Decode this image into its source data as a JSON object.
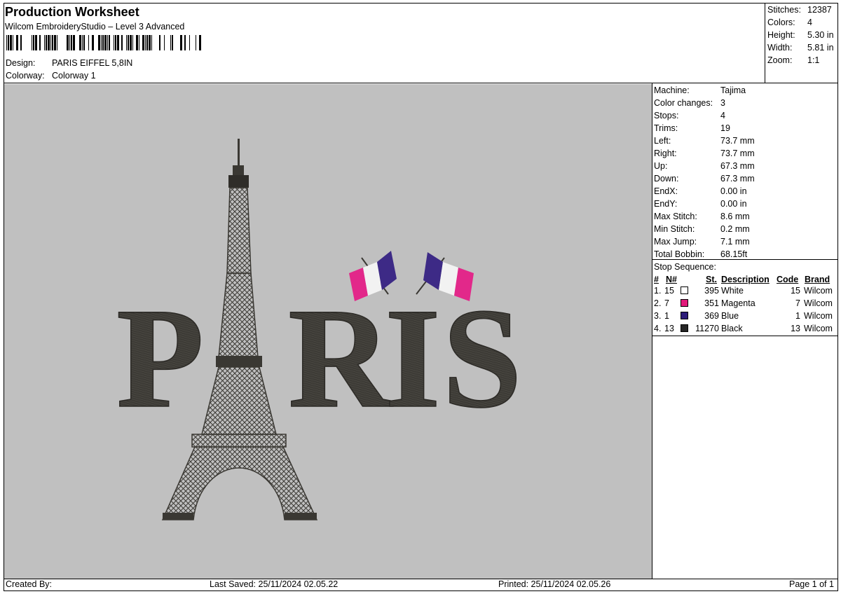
{
  "header": {
    "title": "Production Worksheet",
    "software": "Wilcom EmbroideryStudio – Level 3 Advanced",
    "design_label": "Design:",
    "design_value": "PARIS EIFFEL 5,8IN",
    "colorway_label": "Colorway:",
    "colorway_value": "Colorway 1"
  },
  "summary": [
    {
      "label": "Stitches:",
      "value": "12387"
    },
    {
      "label": "Colors:",
      "value": "4"
    },
    {
      "label": "Height:",
      "value": "5.30 in"
    },
    {
      "label": "Width:",
      "value": "5.81 in"
    },
    {
      "label": "Zoom:",
      "value": "1:1"
    }
  ],
  "details": [
    {
      "label": "Machine:",
      "value": "Tajima"
    },
    {
      "label": "Color changes:",
      "value": "3"
    },
    {
      "label": "Stops:",
      "value": "4"
    },
    {
      "label": "Trims:",
      "value": "19"
    },
    {
      "label": "Left:",
      "value": "73.7 mm"
    },
    {
      "label": "Right:",
      "value": "73.7 mm"
    },
    {
      "label": "Up:",
      "value": "67.3 mm"
    },
    {
      "label": "Down:",
      "value": "67.3 mm"
    },
    {
      "label": "EndX:",
      "value": "0.00 in"
    },
    {
      "label": "EndY:",
      "value": "0.00 in"
    },
    {
      "label": "Max Stitch:",
      "value": "8.6 mm"
    },
    {
      "label": "Min Stitch:",
      "value": "0.2 mm"
    },
    {
      "label": "Max Jump:",
      "value": "7.1 mm"
    },
    {
      "label": "Total Bobbin:",
      "value": "68.15ft"
    }
  ],
  "stop_sequence": {
    "title": "Stop Sequence:",
    "columns": [
      "#",
      "N#",
      "St.",
      "Description",
      "Code",
      "Brand"
    ],
    "rows": [
      {
        "idx": "1.",
        "n": "15",
        "color": "#ffffff",
        "st": "395",
        "desc": "White",
        "code": "15",
        "brand": "Wilcom"
      },
      {
        "idx": "2.",
        "n": "7",
        "color": "#e2197a",
        "st": "351",
        "desc": "Magenta",
        "code": "7",
        "brand": "Wilcom"
      },
      {
        "idx": "3.",
        "n": "1",
        "color": "#2c1c78",
        "st": "369",
        "desc": "Blue",
        "code": "1",
        "brand": "Wilcom"
      },
      {
        "idx": "4.",
        "n": "13",
        "color": "#262626",
        "st": "11270",
        "desc": "Black",
        "code": "13",
        "brand": "Wilcom"
      }
    ]
  },
  "design_text": "PARIS",
  "footer": {
    "created_by": "Created By:",
    "last_saved": "Last Saved: 25/11/2024 02.05.22",
    "printed": "Printed: 25/11/2024 02.05.26",
    "page": "Page 1 of 1"
  },
  "colors": {
    "canvas_bg": "#c0c0c0",
    "thread_dark": "#3a3833",
    "flag_blue": "#3d2a86",
    "flag_white": "#f2f2f2",
    "flag_magenta": "#e2288a"
  }
}
